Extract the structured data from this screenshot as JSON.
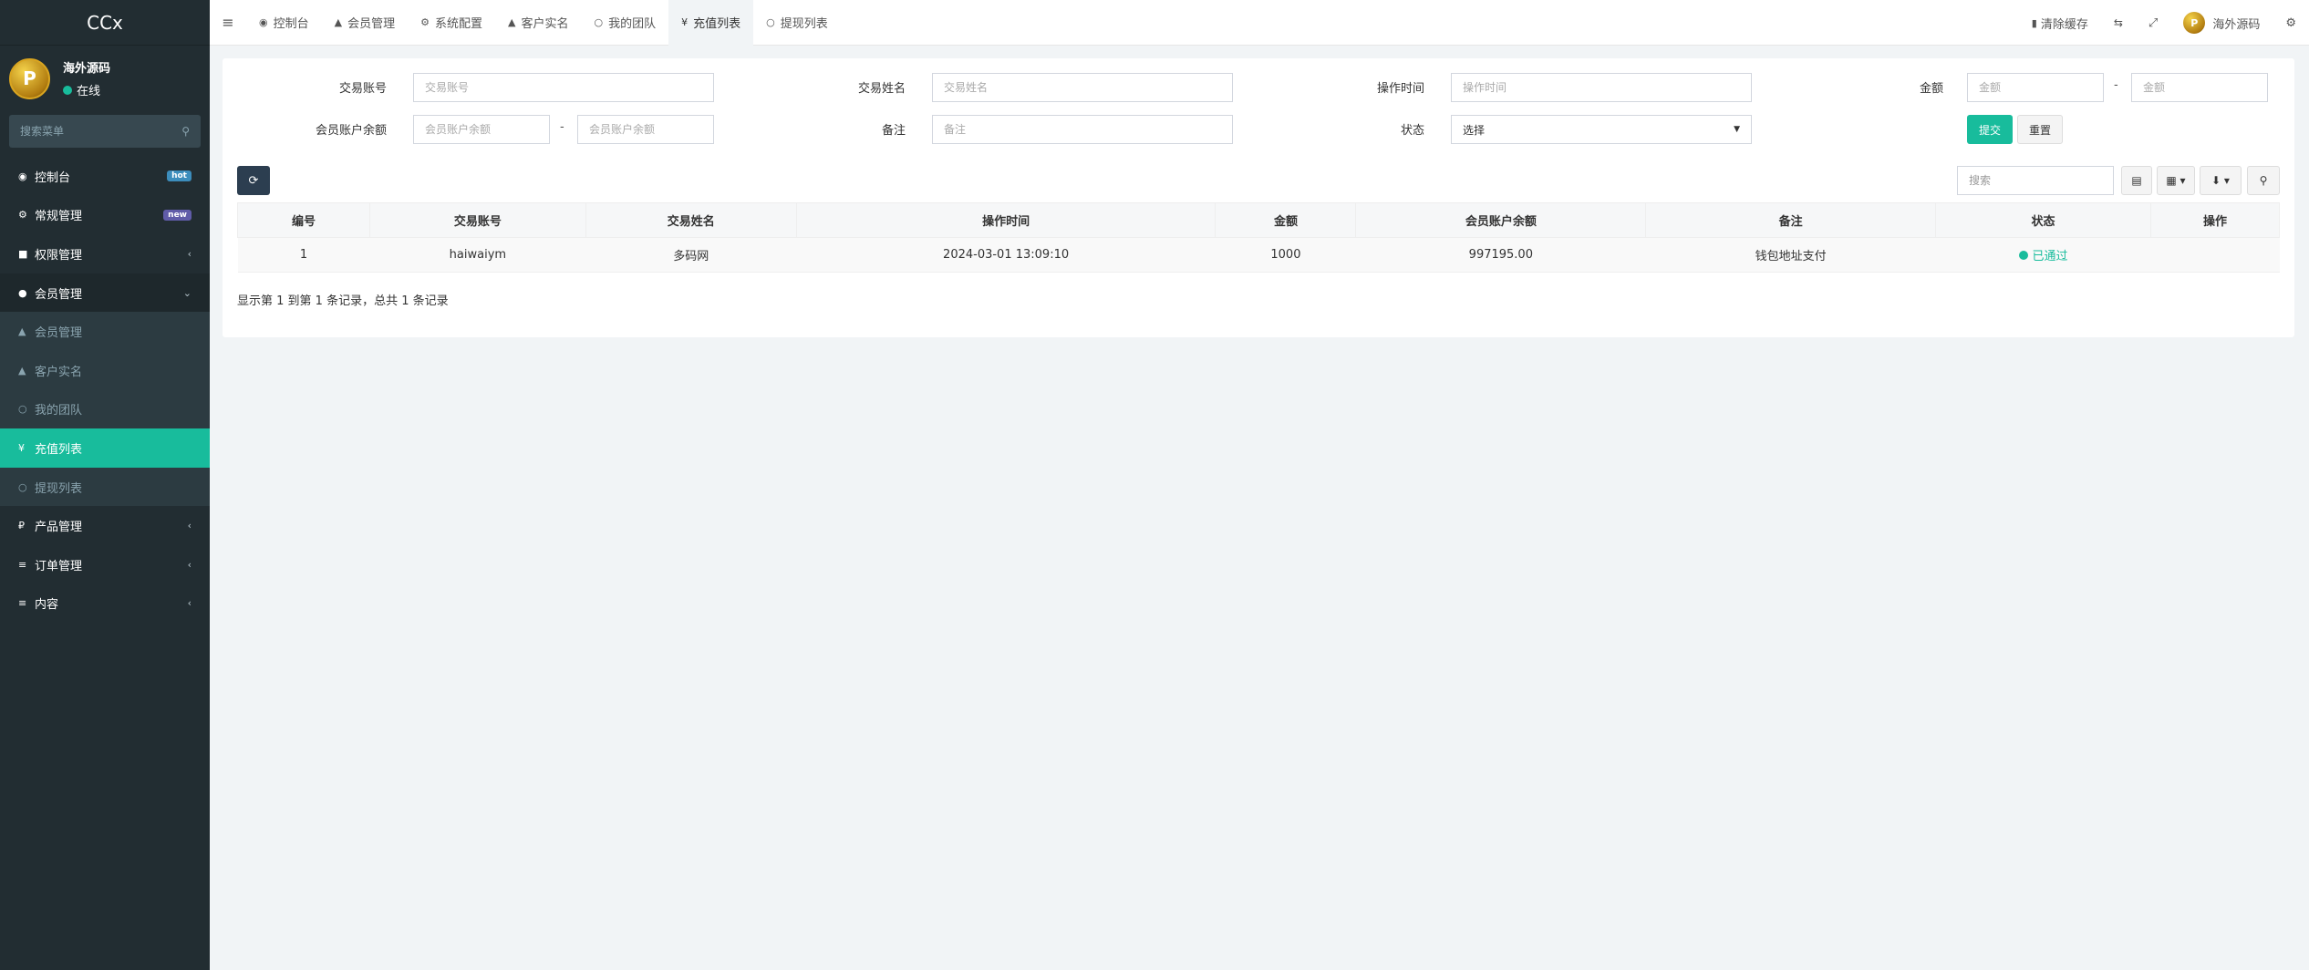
{
  "app": {
    "logo": "CCx"
  },
  "user": {
    "name": "海外源码",
    "status": "在线",
    "avatar_letter": "P"
  },
  "sidebar": {
    "search_placeholder": "搜索菜单",
    "items": [
      {
        "icon": "dashboard-icon",
        "glyph": "◉",
        "label": "控制台",
        "badge": "hot"
      },
      {
        "icon": "cogs-icon",
        "glyph": "⚙",
        "label": "常规管理",
        "badge": "new"
      },
      {
        "icon": "users-icon",
        "glyph": "👥",
        "label": "权限管理",
        "arrow": "‹"
      },
      {
        "icon": "user-circle-icon",
        "glyph": "●",
        "label": "会员管理",
        "arrow": "⌄"
      }
    ],
    "subitems": [
      {
        "icon": "user-icon",
        "glyph": "▲",
        "label": "会员管理"
      },
      {
        "icon": "user-icon",
        "glyph": "▲",
        "label": "客户实名"
      },
      {
        "icon": "circle-icon",
        "glyph": "○",
        "label": "我的团队"
      },
      {
        "icon": "yen-icon",
        "glyph": "¥",
        "label": "充值列表"
      },
      {
        "icon": "circle-icon",
        "glyph": "○",
        "label": "提现列表"
      }
    ],
    "items2": [
      {
        "icon": "ruble-icon",
        "glyph": "₽",
        "label": "产品管理",
        "arrow": "‹"
      },
      {
        "icon": "list-icon",
        "glyph": "≡",
        "label": "订单管理",
        "arrow": "‹"
      },
      {
        "icon": "list-icon",
        "glyph": "≡",
        "label": "内容",
        "arrow": "‹"
      }
    ]
  },
  "topnav": {
    "tabs": [
      {
        "glyph": "◉",
        "label": "控制台"
      },
      {
        "glyph": "▲",
        "label": "会员管理"
      },
      {
        "glyph": "⚙",
        "label": "系统配置"
      },
      {
        "glyph": "▲",
        "label": "客户实名"
      },
      {
        "glyph": "○",
        "label": "我的团队"
      },
      {
        "glyph": "¥",
        "label": "充值列表"
      },
      {
        "glyph": "○",
        "label": "提现列表"
      }
    ],
    "clear_cache": "清除缓存",
    "user_name": "海外源码"
  },
  "filters": {
    "account_label": "交易账号",
    "account_placeholder": "交易账号",
    "name_label": "交易姓名",
    "name_placeholder": "交易姓名",
    "time_label": "操作时间",
    "time_placeholder": "操作时间",
    "amount_label": "金额",
    "amount_min_placeholder": "金额",
    "amount_max_placeholder": "金额",
    "balance_label": "会员账户余额",
    "balance_min_placeholder": "会员账户余额",
    "balance_max_placeholder": "会员账户余额",
    "remark_label": "备注",
    "remark_placeholder": "备注",
    "status_label": "状态",
    "status_value": "选择",
    "range_dash": "-",
    "submit": "提交",
    "reset": "重置"
  },
  "toolbar": {
    "search_placeholder": "搜索"
  },
  "table": {
    "headers": [
      "编号",
      "交易账号",
      "交易姓名",
      "操作时间",
      "金额",
      "会员账户余额",
      "备注",
      "状态",
      "操作"
    ],
    "rows": [
      {
        "id": "1",
        "account": "haiwaiym",
        "name": "多码网",
        "time": "2024-03-01 13:09:10",
        "amount": "1000",
        "balance": "997195.00",
        "remark": "钱包地址支付",
        "status": "已通过"
      }
    ]
  },
  "pager": {
    "summary": "显示第 1 到第 1 条记录，总共 1 条记录"
  },
  "colors": {
    "accent": "#18bc9c",
    "sidebar": "#222d32",
    "dark_button": "#2c3e50"
  }
}
